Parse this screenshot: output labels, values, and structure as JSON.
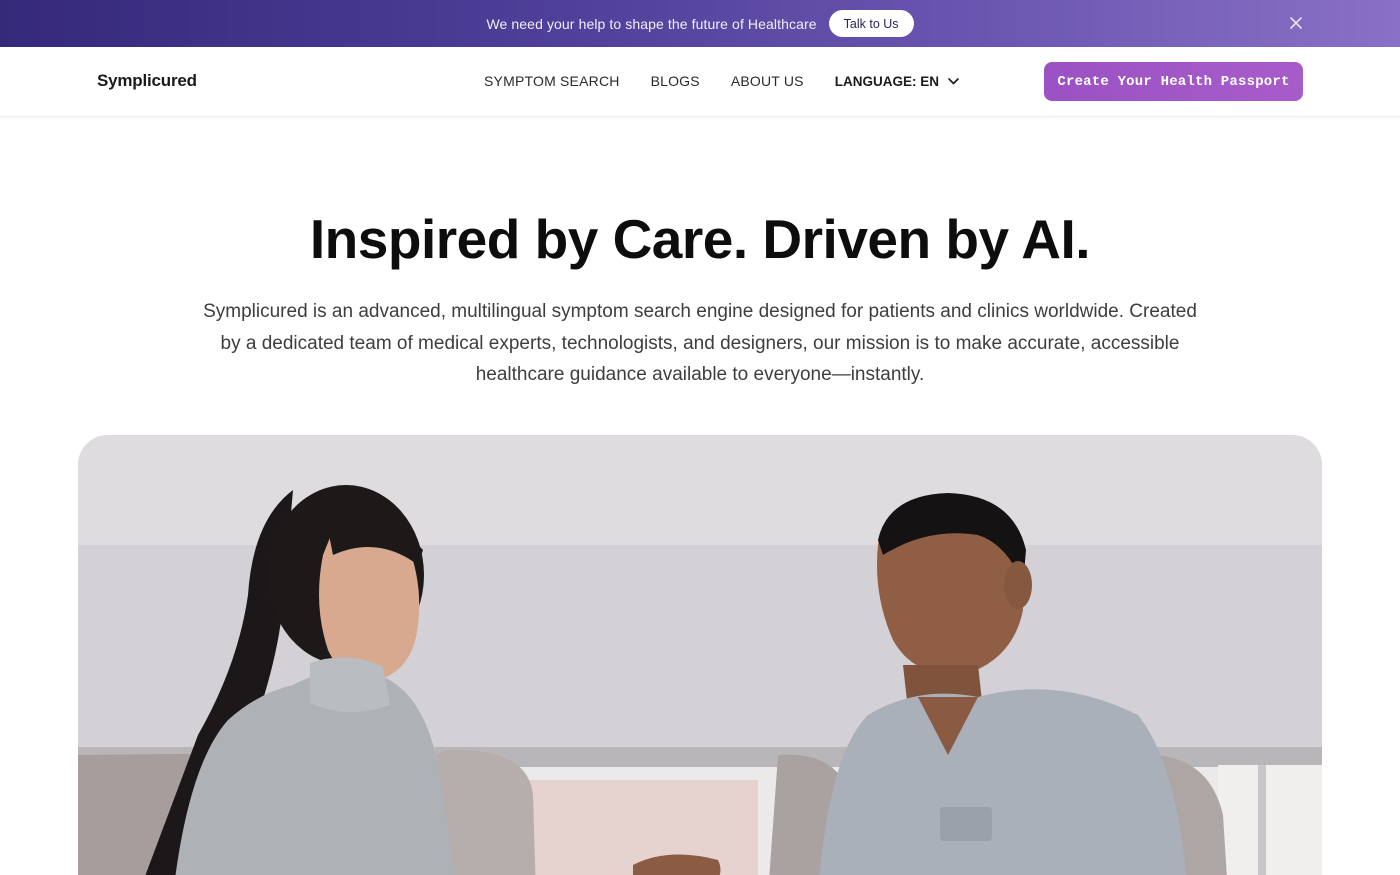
{
  "banner": {
    "text": "We need your help to shape the future of Healthcare",
    "button_label": "Talk to Us",
    "close_icon": "close-icon"
  },
  "header": {
    "logo": "Symplicured",
    "nav": {
      "symptom_search": "SYMPTOM SEARCH",
      "blogs": "BLOGS",
      "about_us": "ABOUT US",
      "language": "LANGUAGE: EN",
      "language_icon": "chevron-down-icon"
    },
    "cta_label": "Create Your Health Passport"
  },
  "hero": {
    "title": "Inspired by Care. Driven by AI.",
    "description": "Symplicured is an advanced, multilingual symptom search engine designed for patients and clinics worldwide. Created by a dedicated team of medical experts, technologists, and designers, our mission is to make accurate, accessible healthcare guidance available to everyone—instantly."
  },
  "colors": {
    "banner_start": "#35297a",
    "banner_end": "#8a70c6",
    "cta": "#a75cc8",
    "text": "#0d0d0d"
  }
}
